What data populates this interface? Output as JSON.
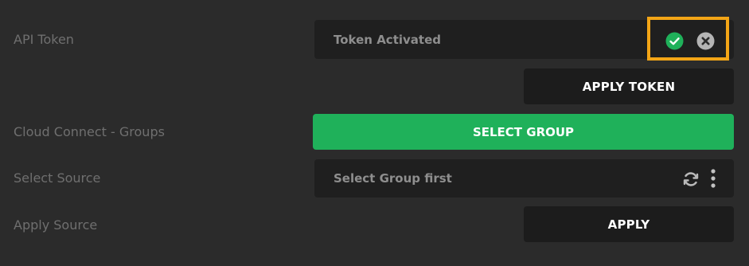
{
  "rows": {
    "api_token": {
      "label": "API Token",
      "field_text": "Token Activated",
      "status_icons": [
        "check-circle-icon",
        "clear-circle-icon"
      ],
      "apply_label": "APPLY TOKEN"
    },
    "groups": {
      "label": "Cloud Connect - Groups",
      "button_label": "SELECT GROUP"
    },
    "source": {
      "label": "Select Source",
      "field_text": "Select Group first",
      "icons": [
        "refresh-icon",
        "more-vertical-icon"
      ]
    },
    "apply_source": {
      "label": "Apply Source",
      "button_label": "APPLY"
    }
  },
  "colors": {
    "background": "#2b2b2b",
    "field": "#1f1f1f",
    "green": "#1fb15a",
    "highlight": "#f3a516",
    "label": "#6f6f6f"
  }
}
